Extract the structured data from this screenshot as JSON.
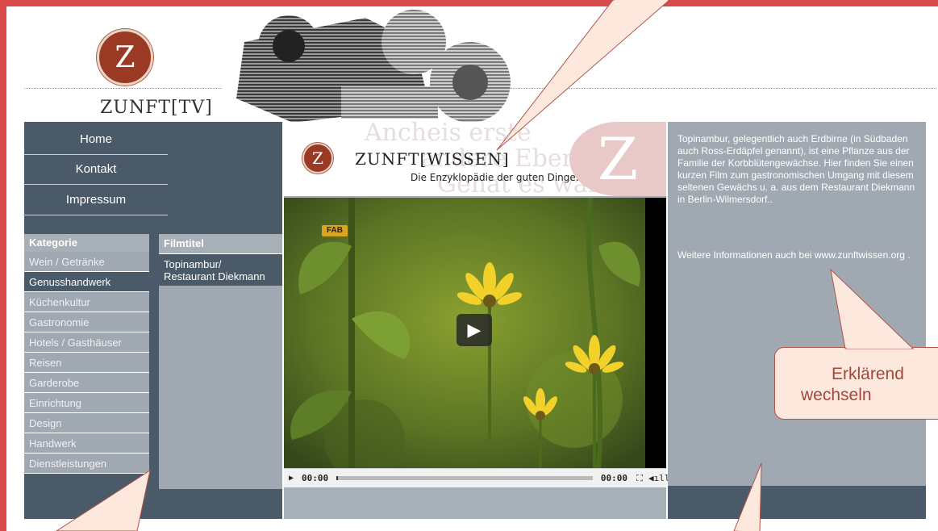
{
  "header": {
    "logo_letter": "Z",
    "logo_text": "ZUNFT[TV]"
  },
  "nav": {
    "items": [
      {
        "label": "Home"
      },
      {
        "label": "Kontakt"
      },
      {
        "label": "Impressum"
      }
    ]
  },
  "categories": {
    "header": "Kategorie",
    "items": [
      {
        "label": "Wein / Getränke",
        "active": false
      },
      {
        "label": "Genusshandwerk",
        "active": true
      },
      {
        "label": "Küchenkultur",
        "active": false
      },
      {
        "label": "Gastronomie",
        "active": false
      },
      {
        "label": "Hotels / Gasthäuser",
        "active": false
      },
      {
        "label": "Reisen",
        "active": false
      },
      {
        "label": "Garderobe",
        "active": false
      },
      {
        "label": "Einrichtung",
        "active": false
      },
      {
        "label": "Design",
        "active": false
      },
      {
        "label": "Handwerk",
        "active": false
      },
      {
        "label": "Dienstleistungen",
        "active": false
      }
    ]
  },
  "films": {
    "header": "Filmtitel",
    "items": [
      {
        "line1": "Topinambur/",
        "line2": "Restaurant Diekmann"
      }
    ]
  },
  "banner": {
    "logo_letter": "Z",
    "title": "ZUNFT[WISSEN]",
    "subtitle": "Die Enzyklopädie der guten Dinge.",
    "watermark_letter": "Z"
  },
  "video": {
    "badge": "FAB",
    "time_current": "00:00",
    "time_total": "00:00"
  },
  "info": {
    "description": "Topinambur, gelegentlich auch Erdbirne (in Südbaden auch Ross-Erdäpfel genannt), ist eine Pflanze aus der Familie der Korbblütengewächse. Hier finden Sie einen kurzen Film zum gastronomischen Umgang mit diesem seltenen Gewächs u. a. aus dem Restaurant Diekmann in Berlin-Wilmersdorf..",
    "more": "Weitere Informationen auch bei www.zunftwissen.org ."
  },
  "callout": {
    "line1": "Erklärend",
    "line2": "wechseln"
  },
  "colors": {
    "frame": "#d94a4a",
    "nav_dark": "#4a5a69",
    "panel_gray": "#a0a9b2",
    "logo_red": "#9b3a24"
  }
}
